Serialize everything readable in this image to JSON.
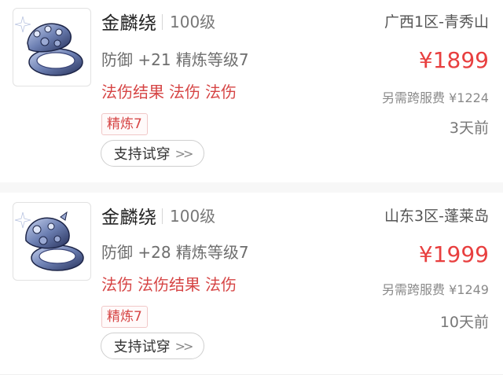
{
  "listings": [
    {
      "item_name": "金麟绕",
      "level": "100级",
      "server": "广西1区-青秀山",
      "stats": "防御 +21 精炼等级7",
      "price": "¥1899",
      "effects": [
        "法伤结果",
        "法伤",
        "法伤"
      ],
      "cross_server_fee": "另需跨服费 ¥1224",
      "refine_tag": "精炼7",
      "listed_time": "3天前",
      "try_on_label": "支持试穿",
      "icon": "ring-icon"
    },
    {
      "item_name": "金麟绕",
      "level": "100级",
      "server": "山东3区-蓬莱岛",
      "stats": "防御 +28 精炼等级7",
      "price": "¥1999",
      "effects": [
        "法伤",
        "法伤结果",
        "法伤"
      ],
      "cross_server_fee": "另需跨服费 ¥1249",
      "refine_tag": "精炼7",
      "listed_time": "10天前",
      "try_on_label": "支持试穿",
      "icon": "ring-icon"
    }
  ],
  "colors": {
    "price": "#e83f3f",
    "effect": "#d64545",
    "ring_metal": "#6c7fb2"
  }
}
